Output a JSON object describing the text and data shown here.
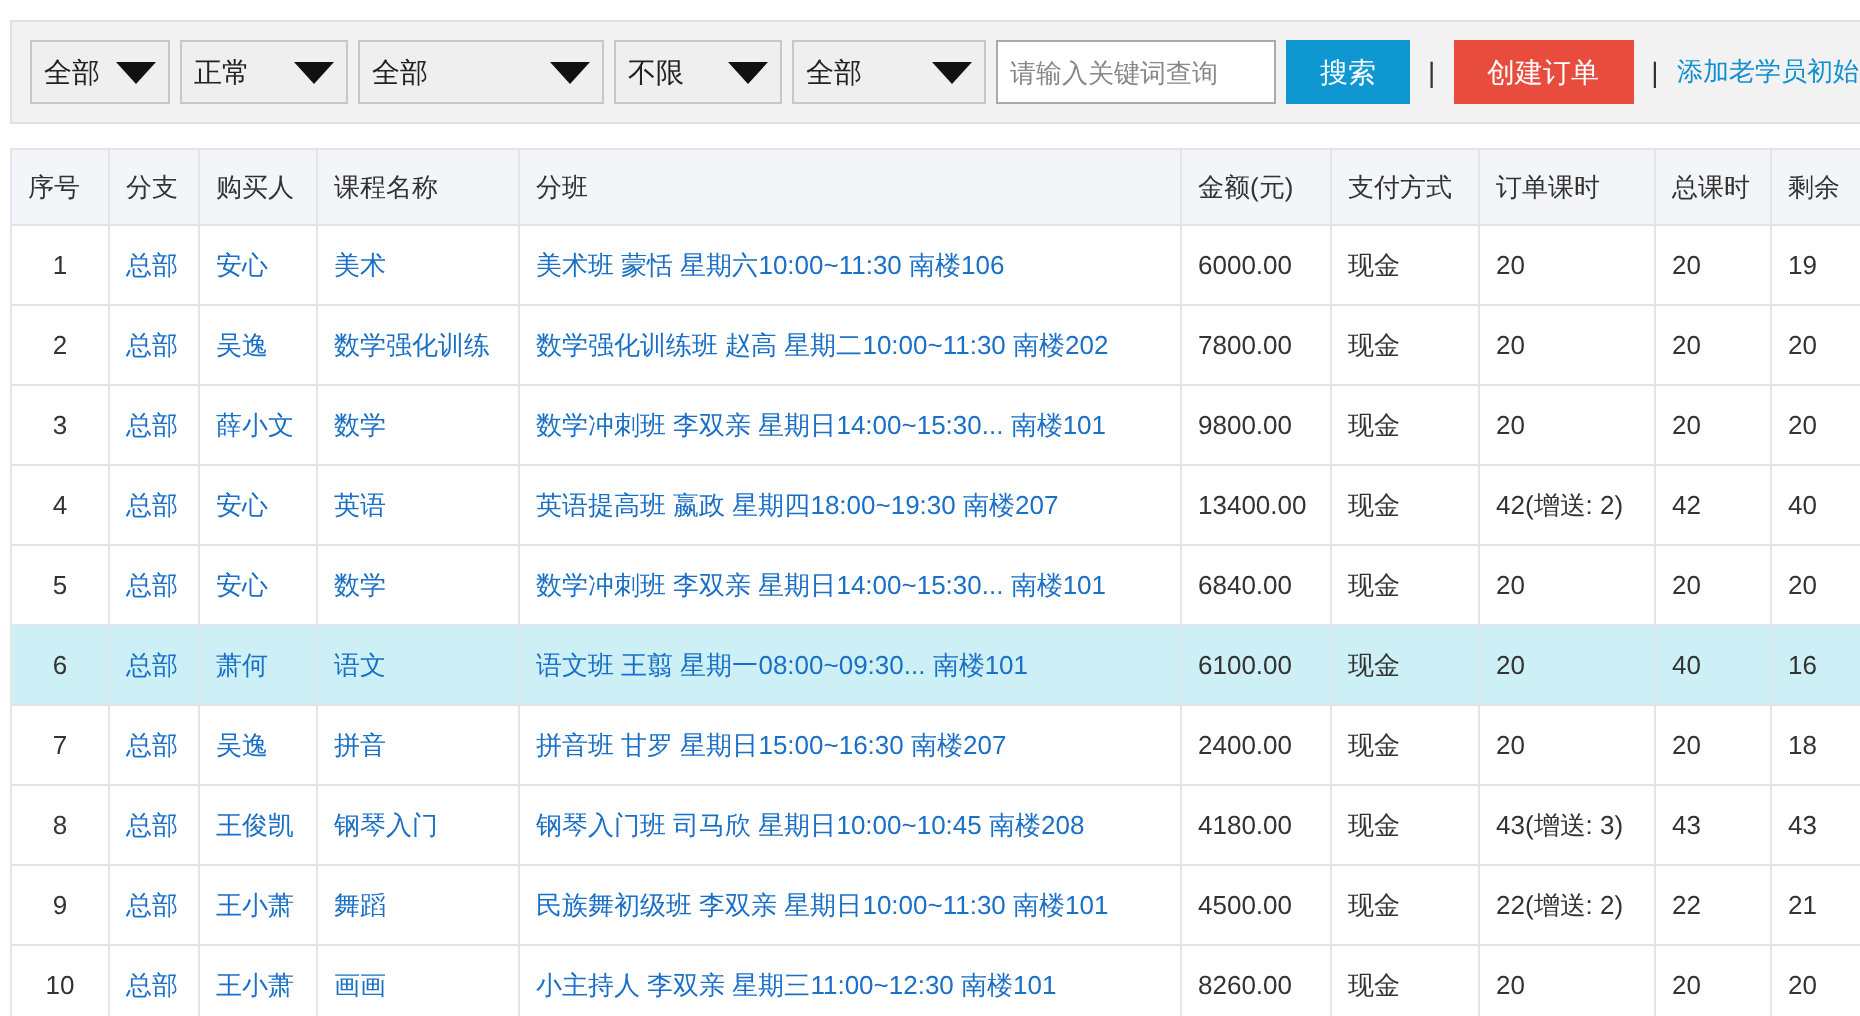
{
  "filters": [
    {
      "value": "全部"
    },
    {
      "value": "正常"
    },
    {
      "value": "全部"
    },
    {
      "value": "不限"
    },
    {
      "value": "全部"
    }
  ],
  "search": {
    "placeholder": "请输入关键词查询",
    "button": "搜索"
  },
  "separators": [
    "|",
    "|"
  ],
  "create_button": "创建订单",
  "add_link": "添加老学员初始",
  "table": {
    "columns": [
      "序号",
      "分支",
      "购买人",
      "课程名称",
      "分班",
      "金额(元)",
      "支付方式",
      "订单课时",
      "总课时",
      "剩余"
    ],
    "rows": [
      {
        "selected": false,
        "cells": [
          "1",
          "总部",
          "安心",
          "美术",
          "美术班 蒙恬 星期六10:00~11:30 南楼106",
          "6000.00",
          "现金",
          "20",
          "20",
          "19"
        ]
      },
      {
        "selected": false,
        "cells": [
          "2",
          "总部",
          "吴逸",
          "数学强化训练",
          "数学强化训练班 赵高 星期二10:00~11:30 南楼202",
          "7800.00",
          "现金",
          "20",
          "20",
          "20"
        ]
      },
      {
        "selected": false,
        "cells": [
          "3",
          "总部",
          "薛小文",
          "数学",
          "数学冲刺班 李双亲 星期日14:00~15:30... 南楼101",
          "9800.00",
          "现金",
          "20",
          "20",
          "20"
        ]
      },
      {
        "selected": false,
        "cells": [
          "4",
          "总部",
          "安心",
          "英语",
          "英语提高班 嬴政 星期四18:00~19:30 南楼207",
          "13400.00",
          "现金",
          "42(增送: 2)",
          "42",
          "40"
        ]
      },
      {
        "selected": false,
        "cells": [
          "5",
          "总部",
          "安心",
          "数学",
          "数学冲刺班 李双亲 星期日14:00~15:30... 南楼101",
          "6840.00",
          "现金",
          "20",
          "20",
          "20"
        ]
      },
      {
        "selected": true,
        "cells": [
          "6",
          "总部",
          "萧何",
          "语文",
          "语文班 王翦 星期一08:00~09:30... 南楼101",
          "6100.00",
          "现金",
          "20",
          "40",
          "16"
        ]
      },
      {
        "selected": false,
        "cells": [
          "7",
          "总部",
          "吴逸",
          "拼音",
          "拼音班 甘罗 星期日15:00~16:30 南楼207",
          "2400.00",
          "现金",
          "20",
          "20",
          "18"
        ]
      },
      {
        "selected": false,
        "cells": [
          "8",
          "总部",
          "王俊凯",
          "钢琴入门",
          "钢琴入门班 司马欣 星期日10:00~10:45 南楼208",
          "4180.00",
          "现金",
          "43(增送: 3)",
          "43",
          "43"
        ]
      },
      {
        "selected": false,
        "cells": [
          "9",
          "总部",
          "王小萧",
          "舞蹈",
          "民族舞初级班 李双亲 星期日10:00~11:30 南楼101",
          "4500.00",
          "现金",
          "22(增送: 2)",
          "22",
          "21"
        ]
      },
      {
        "selected": false,
        "cells": [
          "10",
          "总部",
          "王小萧",
          "画画",
          "小主持人 李双亲 星期三11:00~12:30 南楼101",
          "8260.00",
          "现金",
          "20",
          "20",
          "20"
        ]
      }
    ]
  }
}
